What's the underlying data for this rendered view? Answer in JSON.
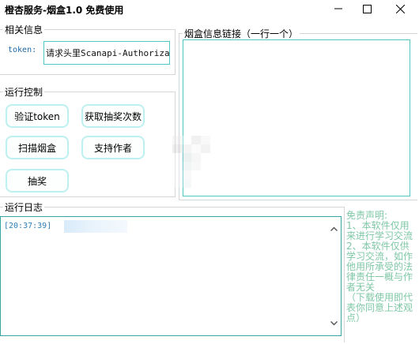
{
  "window": {
    "title": "橙杏服务-烟盒1.0 免费使用"
  },
  "info_group": {
    "title": "相关信息",
    "token_label": "token:",
    "token_value": "请求头里Scanapi-Authorizat"
  },
  "control_group": {
    "title": "运行控制",
    "verify_button": "验证token",
    "get_draws_button": "获取抽奖次数",
    "scan_button": "扫描烟盒",
    "support_button": "支持作者",
    "draw_button": "抽奖"
  },
  "url_group": {
    "title": "烟盒信息链接（一行一个）",
    "value": ""
  },
  "log_group": {
    "title": "运行日志",
    "entries": [
      {
        "time": "[20:37:39]"
      }
    ]
  },
  "disclaimer": {
    "text": "免责声明:\n1、本软件仅用来进行学习交流\n2、本软件仅供学习交流，如作他用所承受的法律责任一概与作者无关\n（下载使用即代表你同意上述观点）"
  },
  "icons": [
    "minimize-icon",
    "maximize-icon",
    "close-icon",
    "scroll-up-icon",
    "scroll-down-icon"
  ],
  "colors": {
    "accent": "#4fc7c2",
    "button_border": "#bdf0f0",
    "token_label": "#1e6aa8",
    "log_time": "#2f7fb5",
    "disclaimer": "#7fc7a7"
  }
}
